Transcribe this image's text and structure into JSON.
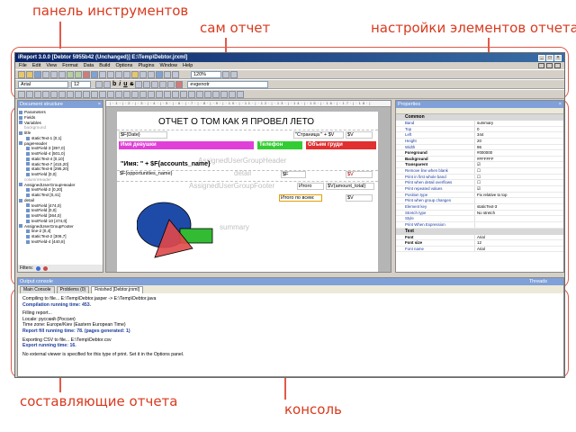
{
  "annotations": {
    "toolbar": "панель инструментов",
    "report": "сам отчет",
    "element_settings": "настройки элементов отчета",
    "components": "составляющие отчета",
    "console": "консоль"
  },
  "window": {
    "title": "iReport 3.0.0  [Debtor 5955b42 (Unchanged)]  E:\\Temp\\Debtor.jrxml]",
    "menu": [
      "File",
      "Edit",
      "View",
      "Format",
      "Data",
      "Build",
      "Options",
      "Plugins",
      "Window",
      "Help"
    ],
    "zoom": "120%",
    "font_name": "Arial",
    "font_size": "12",
    "style_select": "evgenotr"
  },
  "doc_structure": {
    "title": "Document structure",
    "items": [
      "Parameters",
      "Fields",
      "Variables",
      "background",
      "title",
      "staticText-1 [0,1]",
      "pageHeader",
      "textField-3 [397,0]",
      "textField-4 [501,0]",
      "staticText-4 [0,10]",
      "staticText-7 [415,20]",
      "staticText-8 [295,20]",
      "textField [0,0]",
      "columnHeader",
      "AssignedUserGroupHeader",
      "textField-2 [0,20]",
      "staticText [0,41]",
      "detail",
      "textField [474,0]",
      "textField [0,0]",
      "textField [364,0]",
      "textField-10 [474,0]",
      "AssignedUserGroupFooter",
      "line-2 [0,4]",
      "staticText-2 [306,7]",
      "textField-4 [440,8]"
    ],
    "filters_label": "Filters:"
  },
  "report": {
    "title": "ОТЧЕТ О ТОМ КАК Я ПРОВЕЛ ЛЕТО",
    "date_field": "$F{Date}",
    "page_field": "\"Страница \" + $V",
    "page_total": "$V",
    "col_girls": "Имя девушки",
    "col_phone": "Телефон",
    "col_volume": "Объем груди",
    "name_expr": "\"Имя: \" + $F{accounts_name}",
    "ghost_group_header": "AssignedUserGroupHeader",
    "ghost_detail": "detail",
    "ghost_group_footer": "AssignedUserGroupFooter",
    "ghost_summary": "summary",
    "opp_field": "$F{opportunities_name}",
    "dollar_f": "$F",
    "dollar_v": "$V",
    "total_label": "Итого",
    "total_field": "$V{amount_total}",
    "total_all_label": "Итого по всем:",
    "total_all_field": "$V"
  },
  "properties": {
    "title": "Properties",
    "section_common": "Common",
    "section_text": "Text",
    "rows": [
      {
        "k": "Band",
        "v": "summary",
        "bold": false
      },
      {
        "k": "Top",
        "v": "0",
        "bold": false
      },
      {
        "k": "Left",
        "v": "344",
        "bold": false
      },
      {
        "k": "Height",
        "v": "20",
        "bold": false
      },
      {
        "k": "Width",
        "v": "96",
        "bold": false
      },
      {
        "k": "Foreground",
        "v": "#000000",
        "bold": true
      },
      {
        "k": "Background",
        "v": "#FFFFFF",
        "bold": true
      },
      {
        "k": "Transparent",
        "v": "☑",
        "bold": true
      },
      {
        "k": "Remove line when blank",
        "v": "☐",
        "bold": false
      },
      {
        "k": "Print in first whole band",
        "v": "☐",
        "bold": false
      },
      {
        "k": "Print when detail overflows",
        "v": "☐",
        "bold": false
      },
      {
        "k": "Print repeated values",
        "v": "☑",
        "bold": false
      },
      {
        "k": "Position type",
        "v": "Fix relative to top",
        "bold": false
      },
      {
        "k": "Print when group changes",
        "v": "",
        "bold": false
      },
      {
        "k": "Element key",
        "v": "staticText-3",
        "bold": false
      },
      {
        "k": "Stretch type",
        "v": "No stretch",
        "bold": false
      },
      {
        "k": "Style",
        "v": "",
        "bold": false
      },
      {
        "k": "Print When Expression",
        "v": "",
        "bold": false
      }
    ],
    "text_rows": [
      {
        "k": "Font",
        "v": "Arial",
        "bold": true
      },
      {
        "k": "Font size",
        "v": "12",
        "bold": true
      },
      {
        "k": "Font name",
        "v": "Arial",
        "bold": false
      }
    ]
  },
  "console": {
    "title": "Output console",
    "threads_label": "Threads",
    "tabs": [
      "Main Console",
      "Problems (0)",
      "Finished [Debtor.jrxml]"
    ],
    "lines": [
      "Compiling to file... E:\\Temp\\Debtor.jasper -> E:\\Temp\\Debtor.java",
      "Compilation running time: 453.",
      "",
      "Filling report...",
      "Locale: русский (Россия)",
      "Time zone: Europe/Kiev (Eastern European Time)",
      "Report fill running time: 78. (pages generated: 1)",
      "",
      "Exporting CSV to file... E:\\Temp\\Debtor.csv",
      "Export running time: 16.",
      "",
      "No external viewer is specified for this type of print. Set it in the Options panel."
    ]
  },
  "colors": {
    "annotation": "#d93a1e",
    "girls_cell": "#e040d8",
    "phone_cell": "#33cc33",
    "volume_cell": "#e03030",
    "ellipse": "#1f4ba8",
    "rect": "#33bb33",
    "triangle": "#e04848"
  }
}
